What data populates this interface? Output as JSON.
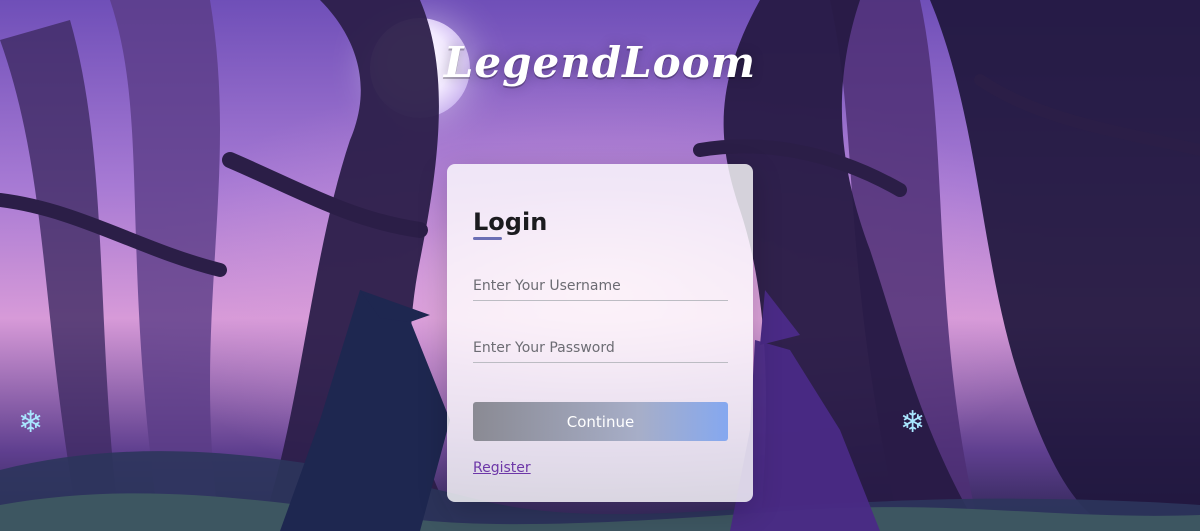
{
  "app": {
    "logo_text": "LegendLoom"
  },
  "login": {
    "title": "Login",
    "username_placeholder": "Enter Your Username",
    "password_placeholder": "Enter Your Password",
    "continue_label": "Continue",
    "register_label": "Register"
  },
  "colors": {
    "accent": "#6d37a8",
    "button_start": "#8a8a93",
    "button_end": "#85a8f0"
  },
  "icons": [
    "moon-decoration",
    "snowflake-icon",
    "snowflake-icon"
  ]
}
